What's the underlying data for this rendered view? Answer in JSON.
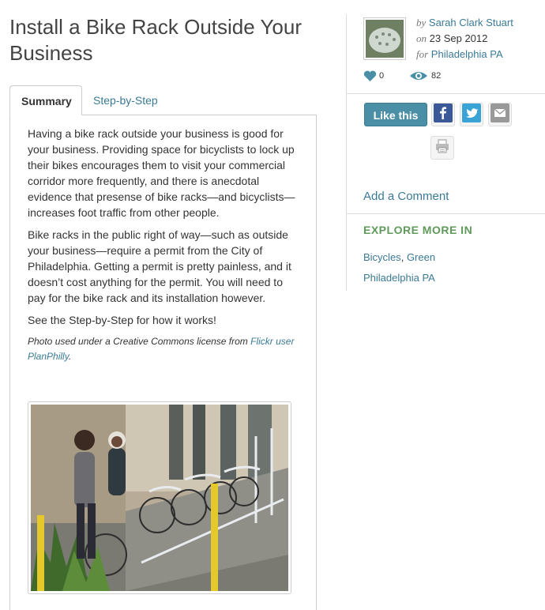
{
  "title": "Install a Bike Rack Outside Your Business",
  "tabs": {
    "summary": "Summary",
    "step": "Step-by-Step"
  },
  "content": {
    "p1": "Having a bike rack outside your business is good for your business. Providing space for bicyclists to lock up their bikes encourages them to visit your commercial corridor more frequently, and there is anecdotal evidence that presense of bike racks—and bicyclists—increases foot traffic from other people.",
    "p2": "Bike racks in the public right of way—such as outside your business—require a permit from the City of Philadelphia. Getting a permit is pretty painless, and it doesn’t cost anything for the permit. You will need to pay for the bike rack and its installation however.",
    "p3": "See the Step-by-Step for how it works!",
    "credit_prefix": "Photo used under a Creative Commons license from ",
    "credit_link": "Flickr user PlanPhilly",
    "credit_suffix": "."
  },
  "author": {
    "by_prefix": "by",
    "name": "Sarah Clark Stuart",
    "on_prefix": "on",
    "date": "23 Sep 2012",
    "for_prefix": "for",
    "location": "Philadelphia PA"
  },
  "stats": {
    "likes": "0",
    "views": "82"
  },
  "actions": {
    "like": "Like this",
    "add_comment": "Add a Comment"
  },
  "explore": {
    "heading": "EXPLORE MORE IN",
    "tag1": "Bicycles",
    "sep": ",",
    "tag2": "Green",
    "place": "Philadelphia PA"
  },
  "colors": {
    "link": "#3a7a96",
    "accent": "#4a8fa6",
    "explore": "#5f9a5a"
  },
  "icons": {
    "likes": "heart-icon",
    "views": "eye-icon",
    "facebook": "facebook-icon",
    "twitter": "twitter-icon",
    "email": "email-icon",
    "print": "print-icon"
  }
}
